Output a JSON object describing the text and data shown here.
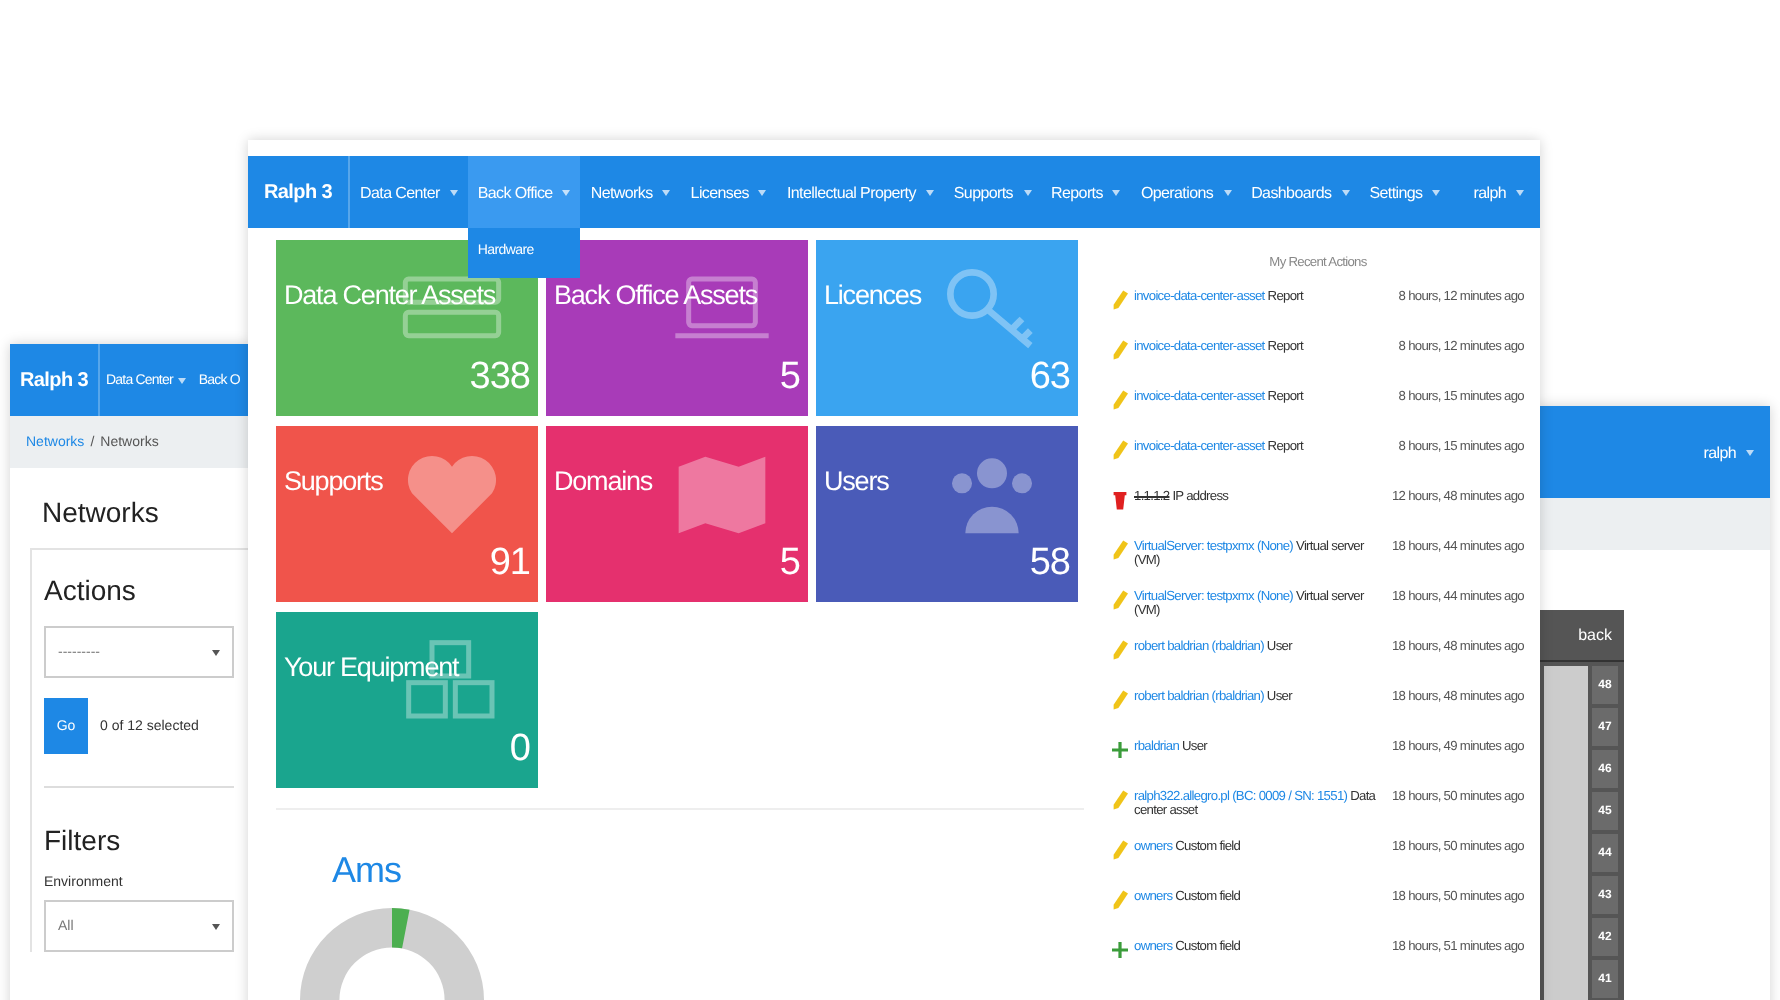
{
  "back_window": {
    "brand": "Ralph 3",
    "nav": [
      "Data Center",
      "Back O"
    ],
    "breadcrumb": {
      "link": "Networks",
      "separator": "/",
      "current": "Networks"
    },
    "heading": "Networks",
    "actions_title": "Actions",
    "action_select": "---------",
    "go_button": "Go",
    "selected_count": "0 of 12 selected",
    "filters_title": "Filters",
    "filter_label": "Environment",
    "filter_select": "All"
  },
  "right_window": {
    "user": "ralph",
    "rack_header": "back",
    "slots": [
      "48",
      "47",
      "46",
      "45",
      "44",
      "43",
      "42",
      "41"
    ]
  },
  "main_window": {
    "brand": "Ralph 3",
    "nav": [
      {
        "label": "Data Center",
        "selected": false
      },
      {
        "label": "Back Office",
        "selected": true
      },
      {
        "label": "Networks",
        "selected": false
      },
      {
        "label": "Licenses",
        "selected": false
      },
      {
        "label": "Intellectual Property",
        "selected": false
      },
      {
        "label": "Supports",
        "selected": false
      },
      {
        "label": "Reports",
        "selected": false
      },
      {
        "label": "Operations",
        "selected": false
      },
      {
        "label": "Dashboards",
        "selected": false
      },
      {
        "label": "Settings",
        "selected": false
      }
    ],
    "user": "ralph",
    "dropdown": [
      "Hardware"
    ],
    "tiles": [
      {
        "kind": "server",
        "title": "Data Center Assets",
        "count": "338",
        "color": "#5cb85c"
      },
      {
        "kind": "laptop",
        "title": "Back Office Assets",
        "count": "5",
        "color": "#a83bb8"
      },
      {
        "kind": "key",
        "title": "Licences",
        "count": "63",
        "color": "#3aa4f0"
      },
      {
        "kind": "heart",
        "title": "Supports",
        "count": "91",
        "color": "#f0544b"
      },
      {
        "kind": "map",
        "title": "Domains",
        "count": "5",
        "color": "#e5306e"
      },
      {
        "kind": "users",
        "title": "Users",
        "count": "58",
        "color": "#4a5bb8"
      },
      {
        "kind": "cubes",
        "title": "Your Equipment",
        "count": "0",
        "color": "#1aa58e"
      }
    ],
    "chart_title": "Ams",
    "recent_title": "My Recent Actions",
    "recent": [
      {
        "kind": "edit",
        "link": "invoice-data-center-asset",
        "type": "Report",
        "time": "8 hours, 12 minutes ago"
      },
      {
        "kind": "edit",
        "link": "invoice-data-center-asset",
        "type": "Report",
        "time": "8 hours, 12 minutes ago"
      },
      {
        "kind": "edit",
        "link": "invoice-data-center-asset",
        "type": "Report",
        "time": "8 hours, 15 minutes ago"
      },
      {
        "kind": "edit",
        "link": "invoice-data-center-asset",
        "type": "Report",
        "time": "8 hours, 15 minutes ago"
      },
      {
        "kind": "delete",
        "link": "1.1.1.2",
        "type": "IP address",
        "time": "12 hours, 48 minutes ago"
      },
      {
        "kind": "edit",
        "link": "VirtualServer: testpxmx (None)",
        "type": "Virtual server (VM)",
        "time": "18 hours, 44 minutes ago"
      },
      {
        "kind": "edit",
        "link": "VirtualServer: testpxmx (None)",
        "type": "Virtual server (VM)",
        "time": "18 hours, 44 minutes ago"
      },
      {
        "kind": "edit",
        "link": "robert baldrian (rbaldrian)",
        "type": "User",
        "time": "18 hours, 48 minutes ago"
      },
      {
        "kind": "edit",
        "link": "robert baldrian (rbaldrian)",
        "type": "User",
        "time": "18 hours, 48 minutes ago"
      },
      {
        "kind": "add",
        "link": "rbaldrian",
        "type": "User",
        "time": "18 hours, 49 minutes ago"
      },
      {
        "kind": "edit",
        "link": "ralph322.allegro.pl (BC: 0009 / SN: 1551)",
        "type": "Data center asset",
        "time": "18 hours, 50 minutes ago"
      },
      {
        "kind": "edit",
        "link": "owners",
        "type": "Custom field",
        "time": "18 hours, 50 minutes ago"
      },
      {
        "kind": "edit",
        "link": "owners",
        "type": "Custom field",
        "time": "18 hours, 50 minutes ago"
      },
      {
        "kind": "add",
        "link": "owners",
        "type": "Custom field",
        "time": "18 hours, 51 minutes ago"
      }
    ]
  }
}
